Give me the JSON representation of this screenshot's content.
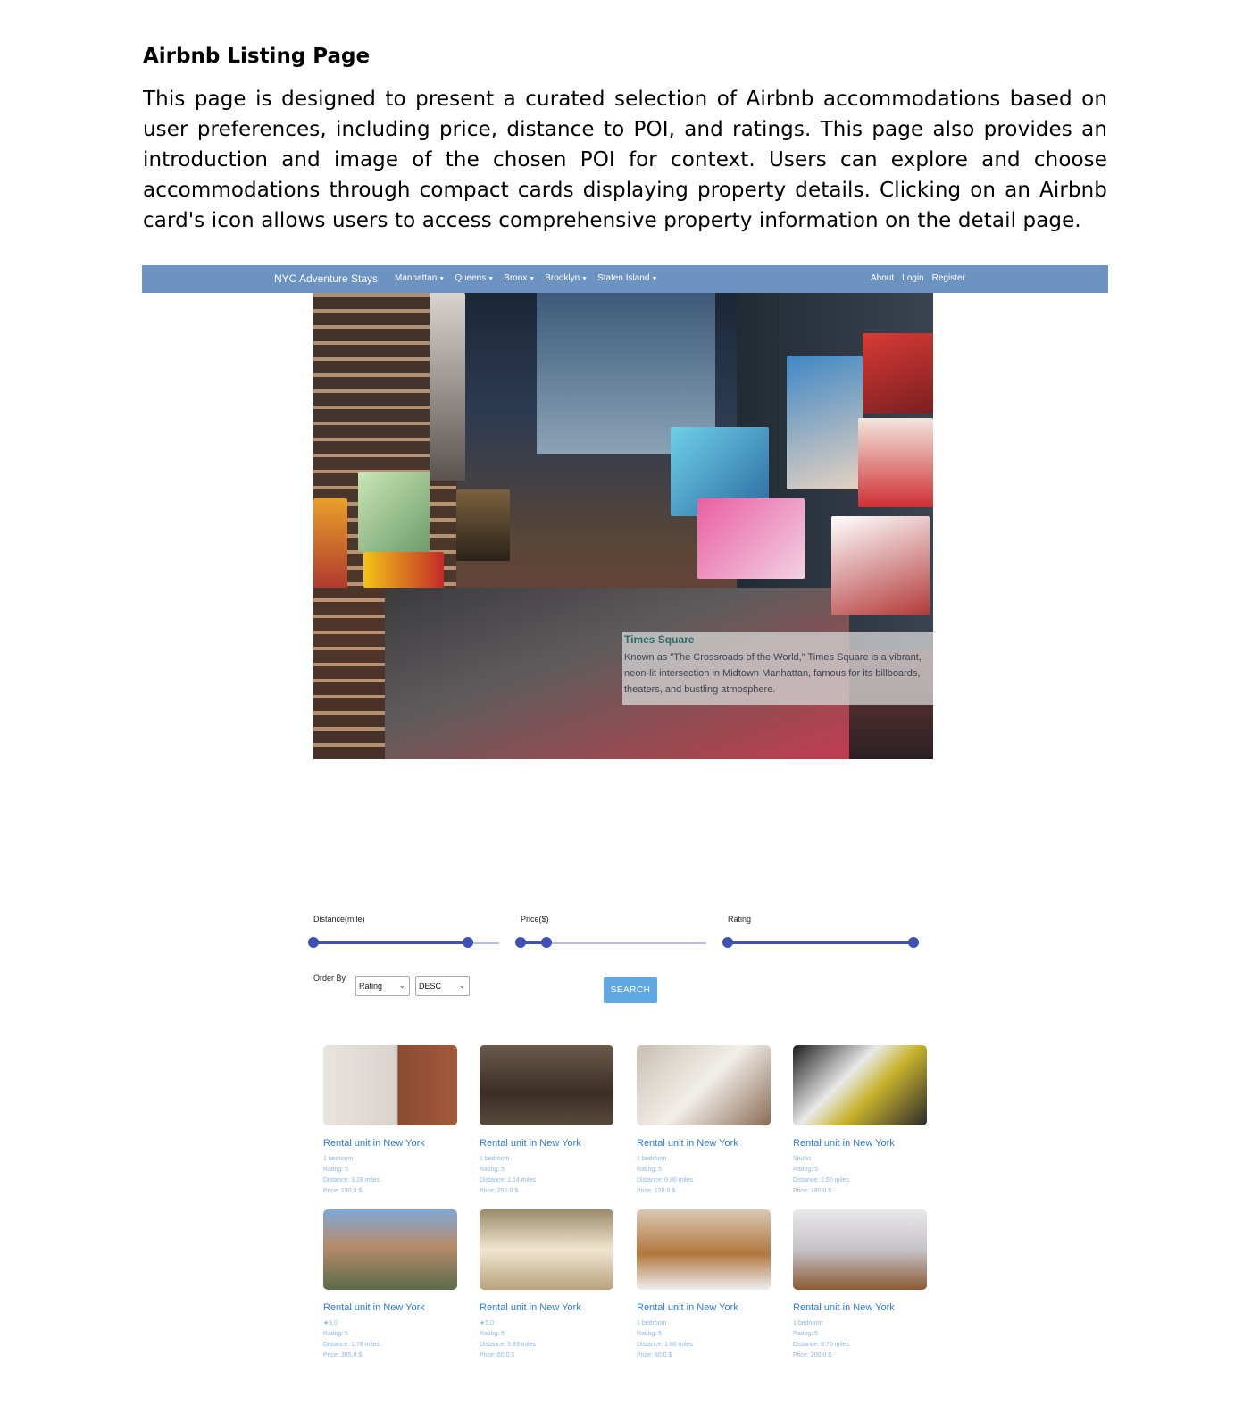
{
  "document": {
    "title": "Airbnb Listing Page",
    "description": "This page is designed to present a curated selection of Airbnb accommodations based on user preferences, including price, distance to POI, and ratings. This page also provides an introduction and image of the chosen POI for context. Users can explore and choose accommodations through compact cards displaying property details. Clicking on an Airbnb card's icon allows users to access comprehensive property information on the detail page."
  },
  "navbar": {
    "brand": "NYC Adventure Stays",
    "menu": [
      "Manhattan",
      "Queens",
      "Bronx",
      "Brooklyn",
      "Staten Island"
    ],
    "right": [
      "About",
      "Login",
      "Register"
    ],
    "color": "#6d93c2"
  },
  "poi": {
    "name": "Times Square",
    "description": "Known as \"The Crossroads of the World,\" Times Square is a vibrant, neon-lit intersection in Midtown Manhattan, famous for its billboards, theaters, and bustling atmosphere."
  },
  "filters": {
    "distance": {
      "label": "Distance(mile)",
      "min_frac": 0.0,
      "max_frac": 0.83
    },
    "price": {
      "label": "Price($)",
      "min_frac": 0.0,
      "max_frac": 0.14
    },
    "rating": {
      "label": "Rating",
      "min_frac": 0.0,
      "max_frac": 1.0
    },
    "order_by_label": "Order By",
    "order_by_value": "Rating",
    "direction_value": "DESC",
    "search_label": "SEARCH",
    "accent": "#3f51b5"
  },
  "cards": [
    {
      "title": "Rental unit in New York",
      "line1": "1 bedroom",
      "rating": "Rating: 5",
      "distance": "Distance: 3.28 miles",
      "price": "Price: 130.0 $"
    },
    {
      "title": "Rental unit in New York",
      "line1": "1 bedroom",
      "rating": "Rating: 5",
      "distance": "Distance: 1.14 miles",
      "price": "Price: 250.0 $"
    },
    {
      "title": "Rental unit in New York",
      "line1": "1 bedroom",
      "rating": "Rating: 5",
      "distance": "Distance: 0.80 miles",
      "price": "Price: 120.0 $"
    },
    {
      "title": "Rental unit in New York",
      "line1": "Studio",
      "rating": "Rating: 5",
      "distance": "Distance: 2.60 miles",
      "price": "Price: 180.0 $"
    },
    {
      "title": "Rental unit in New York",
      "line1": "★5.0",
      "rating": "Rating: 5",
      "distance": "Distance: 1.78 miles",
      "price": "Price: 385.0 $"
    },
    {
      "title": "Rental unit in New York",
      "line1": "★5.0",
      "rating": "Rating: 5",
      "distance": "Distance: 5.83 miles",
      "price": "Price: 60.0 $"
    },
    {
      "title": "Rental unit in New York",
      "line1": "1 bedroom",
      "rating": "Rating: 5",
      "distance": "Distance: 1.86 miles",
      "price": "Price: 80.0 $"
    },
    {
      "title": "Rental unit in New York",
      "line1": "1 bedroom",
      "rating": "Rating: 5",
      "distance": "Distance: 0.76 miles",
      "price": "Price: 200.0 $"
    }
  ]
}
